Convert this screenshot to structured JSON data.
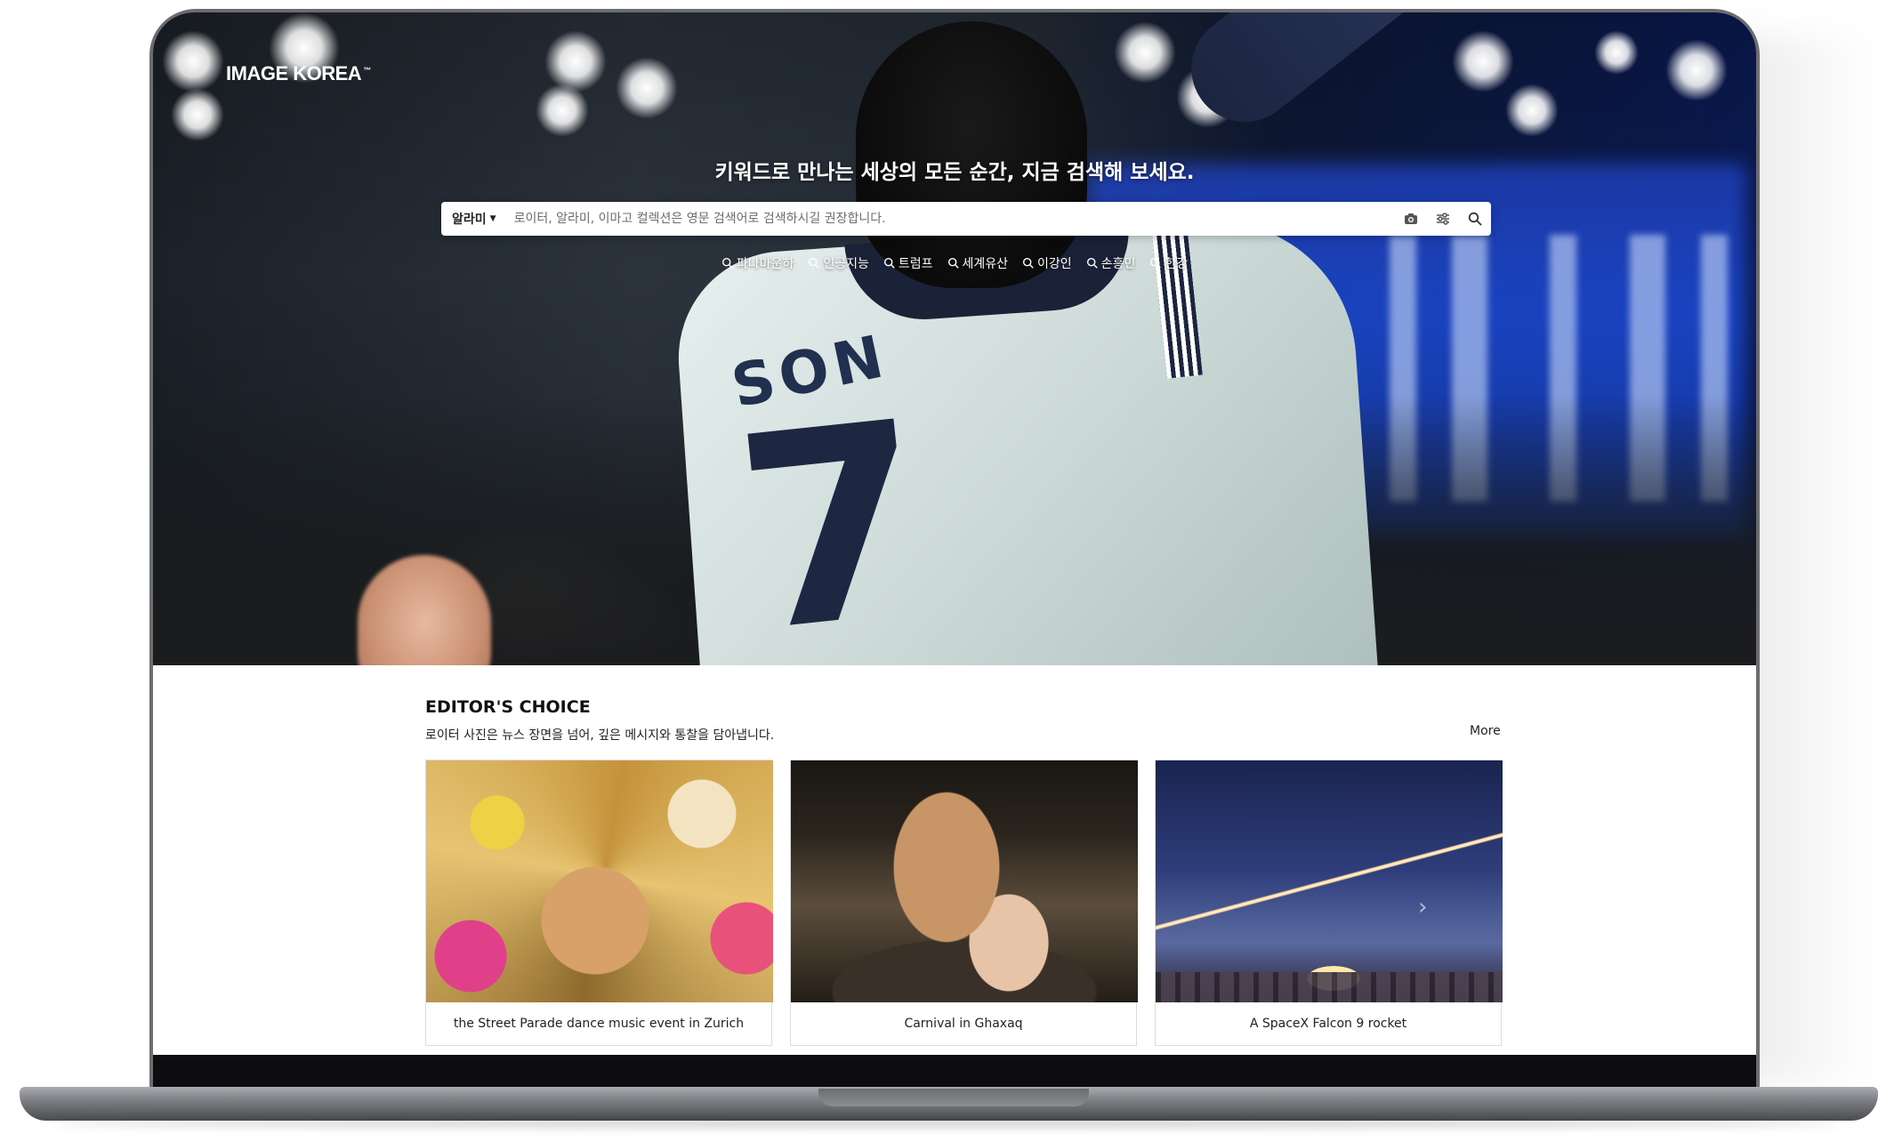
{
  "brand": {
    "logo": "IMAGE KOREA",
    "trademark": "™"
  },
  "hero": {
    "tagline": "키워드로 만나는 세상의 모든 순간, 지금 검색해 보세요.",
    "jersey_name": "SON",
    "jersey_number": "7"
  },
  "search": {
    "collection_selected": "알라미",
    "placeholder": "로이터, 알라미, 이마고 컬렉션은 영문 검색어로 검색하시길 권장합니다.",
    "value": "",
    "icons": [
      "camera-icon",
      "filter-icon",
      "search-icon"
    ]
  },
  "trending": [
    {
      "label": "파나마운하"
    },
    {
      "label": "인공지능"
    },
    {
      "label": "트럼프"
    },
    {
      "label": "세계유산"
    },
    {
      "label": "이강인"
    },
    {
      "label": "손흥민"
    },
    {
      "label": "한강"
    }
  ],
  "editors_choice": {
    "title": "EDITOR'S CHOICE",
    "subtitle": "로이터 사진은 뉴스 장면을 넘어, 깊은 메시지와 통찰을 담아냅니다.",
    "more_label": "More",
    "cards": [
      {
        "caption": "the Street Parade dance music event in Zurich"
      },
      {
        "caption": "Carnival in Ghaxaq"
      },
      {
        "caption": "A SpaceX Falcon 9 rocket"
      }
    ]
  },
  "colors": {
    "hero_blue": "#1d4bd6",
    "text_dark": "#111111",
    "search_bg": "#ffffff"
  }
}
